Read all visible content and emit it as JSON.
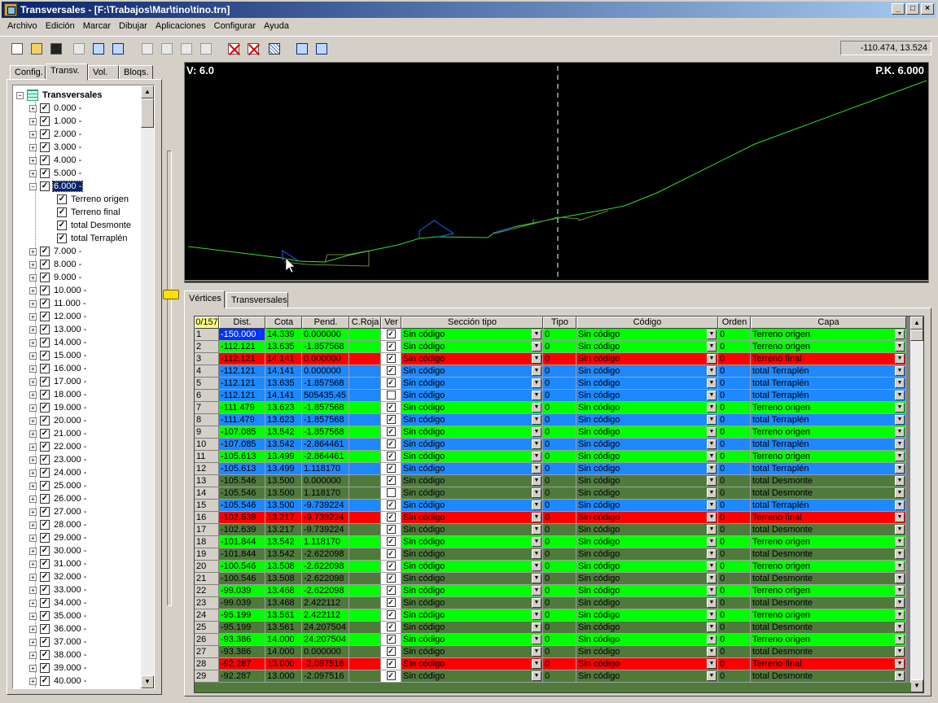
{
  "window": {
    "title": "Transversales - [F:\\Trabajos\\Mar\\tino\\tino.trn]"
  },
  "menu": [
    "Archivo",
    "Edición",
    "Marcar",
    "Dibujar",
    "Aplicaciones",
    "Configurar",
    "Ayuda"
  ],
  "toolbar": {
    "buttons": [
      "new-file-icon",
      "open-folder-icon",
      "save-icon",
      "print-icon",
      "export-icon",
      "import-icon",
      "cut-icon",
      "copy-icon",
      "paste-icon",
      "paste-special-icon",
      "delete-marked-icon",
      "table-icon",
      "hatch-icon",
      "section-prev-icon",
      "section-next-icon"
    ],
    "coords": "-110.474, 13.524"
  },
  "left_tabs": [
    "Config.",
    "Transv.",
    "Vol.",
    "Bloqs."
  ],
  "tree": {
    "root": "Transversales",
    "stations": [
      "0.000 -",
      "1.000 -",
      "2.000 -",
      "3.000 -",
      "4.000 -",
      "5.000 -",
      "6.000 -",
      "7.000 -",
      "8.000 -",
      "9.000 -",
      "10.000 -",
      "11.000 -",
      "12.000 -",
      "13.000 -",
      "14.000 -",
      "15.000 -",
      "16.000 -",
      "17.000 -",
      "18.000 -",
      "19.000 -",
      "20.000 -",
      "21.000 -",
      "22.000 -",
      "23.000 -",
      "24.000 -",
      "25.000 -",
      "26.000 -",
      "27.000 -",
      "28.000 -",
      "29.000 -",
      "30.000 -",
      "31.000 -",
      "32.000 -",
      "33.000 -",
      "34.000 -",
      "35.000 -",
      "36.000 -",
      "37.000 -",
      "38.000 -",
      "39.000 -",
      "40.000 -"
    ],
    "expanded_index": 6,
    "children": [
      "Terreno origen",
      "Terreno final",
      "total Desmonte",
      "total Terraplén"
    ]
  },
  "canvas": {
    "v_label": "V: 6.0",
    "pk_label": "P.K. 6.000"
  },
  "bottom_tabs": [
    "Vértices",
    "Transversales"
  ],
  "grid": {
    "headers": [
      "0/157",
      "Dist.",
      "Cota",
      "Pend.",
      "C.Roja",
      "Ver",
      "Sección tipo",
      "Tipo",
      "Código",
      "Orden",
      "Capa"
    ],
    "colors": {
      "green": "#00ff00",
      "red": "#ff0000",
      "blue": "#1e88ff",
      "olive": "#4f7a3c"
    },
    "rows": [
      {
        "n": "1",
        "dist": "-150.000",
        "cota": "14.339",
        "pend": "0.000000",
        "ver": true,
        "sec": "Sin código",
        "tipo": "0",
        "cod": "Sin código",
        "orden": "0",
        "capa": "Terreno origen",
        "color": "green"
      },
      {
        "n": "2",
        "dist": "-112.121",
        "cota": "13.635",
        "pend": "-1.857568",
        "ver": true,
        "sec": "Sin código",
        "tipo": "0",
        "cod": "Sin código",
        "orden": "0",
        "capa": "Terreno origen",
        "color": "green"
      },
      {
        "n": "3",
        "dist": "-112.121",
        "cota": "14.141",
        "pend": "0.000000",
        "ver": true,
        "sec": "Sin código",
        "tipo": "0",
        "cod": "Sin código",
        "orden": "0",
        "capa": "Terreno final",
        "color": "red"
      },
      {
        "n": "4",
        "dist": "-112.121",
        "cota": "14.141",
        "pend": "0.000000",
        "ver": true,
        "sec": "Sin código",
        "tipo": "0",
        "cod": "Sin código",
        "orden": "0",
        "capa": "total Terraplén",
        "color": "blue"
      },
      {
        "n": "5",
        "dist": "-112.121",
        "cota": "13.635",
        "pend": "-1.857568",
        "ver": true,
        "sec": "Sin código",
        "tipo": "0",
        "cod": "Sin código",
        "orden": "0",
        "capa": "total Terraplén",
        "color": "blue"
      },
      {
        "n": "6",
        "dist": "-112.121",
        "cota": "14.141",
        "pend": "505435.45",
        "ver": false,
        "sec": "Sin código",
        "tipo": "0",
        "cod": "Sin código",
        "orden": "0",
        "capa": "total Terraplén",
        "color": "blue"
      },
      {
        "n": "7",
        "dist": "-111.479",
        "cota": "13.623",
        "pend": "-1.857568",
        "ver": true,
        "sec": "Sin código",
        "tipo": "0",
        "cod": "Sin código",
        "orden": "0",
        "capa": "Terreno origen",
        "color": "green"
      },
      {
        "n": "8",
        "dist": "-111.479",
        "cota": "13.623",
        "pend": "-1.857568",
        "ver": true,
        "sec": "Sin código",
        "tipo": "0",
        "cod": "Sin código",
        "orden": "0",
        "capa": "total Terraplén",
        "color": "blue"
      },
      {
        "n": "9",
        "dist": "-107.085",
        "cota": "13.542",
        "pend": "-1.857568",
        "ver": true,
        "sec": "Sin código",
        "tipo": "0",
        "cod": "Sin código",
        "orden": "0",
        "capa": "Terreno origen",
        "color": "green"
      },
      {
        "n": "10",
        "dist": "-107.085",
        "cota": "13.542",
        "pend": "-2.864461",
        "ver": true,
        "sec": "Sin código",
        "tipo": "0",
        "cod": "Sin código",
        "orden": "0",
        "capa": "total Terraplén",
        "color": "blue"
      },
      {
        "n": "11",
        "dist": "-105.613",
        "cota": "13.499",
        "pend": "-2.864461",
        "ver": true,
        "sec": "Sin código",
        "tipo": "0",
        "cod": "Sin código",
        "orden": "0",
        "capa": "Terreno origen",
        "color": "green"
      },
      {
        "n": "12",
        "dist": "-105.613",
        "cota": "13.499",
        "pend": "1.118170",
        "ver": true,
        "sec": "Sin código",
        "tipo": "0",
        "cod": "Sin código",
        "orden": "0",
        "capa": "total Terraplén",
        "color": "blue"
      },
      {
        "n": "13",
        "dist": "-105.546",
        "cota": "13.500",
        "pend": "0.000000",
        "ver": true,
        "sec": "Sin código",
        "tipo": "0",
        "cod": "Sin código",
        "orden": "0",
        "capa": "total Desmonte",
        "color": "olive"
      },
      {
        "n": "14",
        "dist": "-105.546",
        "cota": "13.500",
        "pend": "1.118170",
        "ver": false,
        "sec": "Sin código",
        "tipo": "0",
        "cod": "Sin código",
        "orden": "0",
        "capa": "total Desmonte",
        "color": "olive"
      },
      {
        "n": "15",
        "dist": "-105.546",
        "cota": "13.500",
        "pend": "-9.739224",
        "ver": true,
        "sec": "Sin código",
        "tipo": "0",
        "cod": "Sin código",
        "orden": "0",
        "capa": "total Terraplén",
        "color": "blue"
      },
      {
        "n": "16",
        "dist": "-102.639",
        "cota": "13.217",
        "pend": "-9.739224",
        "ver": true,
        "sec": "Sin código",
        "tipo": "0",
        "cod": "Sin código",
        "orden": "0",
        "capa": "Terreno final",
        "color": "red"
      },
      {
        "n": "17",
        "dist": "-102.639",
        "cota": "13.217",
        "pend": "-9.739224",
        "ver": true,
        "sec": "Sin código",
        "tipo": "0",
        "cod": "Sin código",
        "orden": "0",
        "capa": "total Desmonte",
        "color": "olive"
      },
      {
        "n": "18",
        "dist": "-101.844",
        "cota": "13.542",
        "pend": "1.118170",
        "ver": true,
        "sec": "Sin código",
        "tipo": "0",
        "cod": "Sin código",
        "orden": "0",
        "capa": "Terreno origen",
        "color": "green"
      },
      {
        "n": "19",
        "dist": "-101.844",
        "cota": "13.542",
        "pend": "-2.622098",
        "ver": true,
        "sec": "Sin código",
        "tipo": "0",
        "cod": "Sin código",
        "orden": "0",
        "capa": "total Desmonte",
        "color": "olive"
      },
      {
        "n": "20",
        "dist": "-100.546",
        "cota": "13.508",
        "pend": "-2.622098",
        "ver": true,
        "sec": "Sin código",
        "tipo": "0",
        "cod": "Sin código",
        "orden": "0",
        "capa": "Terreno origen",
        "color": "green"
      },
      {
        "n": "21",
        "dist": "-100.546",
        "cota": "13.508",
        "pend": "-2.622098",
        "ver": true,
        "sec": "Sin código",
        "tipo": "0",
        "cod": "Sin código",
        "orden": "0",
        "capa": "total Desmonte",
        "color": "olive"
      },
      {
        "n": "22",
        "dist": "-99.039",
        "cota": "13.468",
        "pend": "-2.622098",
        "ver": true,
        "sec": "Sin código",
        "tipo": "0",
        "cod": "Sin código",
        "orden": "0",
        "capa": "Terreno origen",
        "color": "green"
      },
      {
        "n": "23",
        "dist": "-99.039",
        "cota": "13.468",
        "pend": "2.422112",
        "ver": true,
        "sec": "Sin código",
        "tipo": "0",
        "cod": "Sin código",
        "orden": "0",
        "capa": "total Desmonte",
        "color": "olive"
      },
      {
        "n": "24",
        "dist": "-95.199",
        "cota": "13.561",
        "pend": "2.422112",
        "ver": true,
        "sec": "Sin código",
        "tipo": "0",
        "cod": "Sin código",
        "orden": "0",
        "capa": "Terreno origen",
        "color": "green"
      },
      {
        "n": "25",
        "dist": "-95.199",
        "cota": "13.561",
        "pend": "24.207504",
        "ver": true,
        "sec": "Sin código",
        "tipo": "0",
        "cod": "Sin código",
        "orden": "0",
        "capa": "total Desmonte",
        "color": "olive"
      },
      {
        "n": "26",
        "dist": "-93.386",
        "cota": "14.000",
        "pend": "24.207504",
        "ver": true,
        "sec": "Sin código",
        "tipo": "0",
        "cod": "Sin código",
        "orden": "0",
        "capa": "Terreno origen",
        "color": "green"
      },
      {
        "n": "27",
        "dist": "-93.386",
        "cota": "14.000",
        "pend": "0.000000",
        "ver": true,
        "sec": "Sin código",
        "tipo": "0",
        "cod": "Sin código",
        "orden": "0",
        "capa": "total Desmonte",
        "color": "olive"
      },
      {
        "n": "28",
        "dist": "-92.287",
        "cota": "13.000",
        "pend": "-2.097516",
        "ver": true,
        "sec": "Sin código",
        "tipo": "0",
        "cod": "Sin código",
        "orden": "0",
        "capa": "Terreno final",
        "color": "red"
      },
      {
        "n": "29",
        "dist": "-92.287",
        "cota": "13.000",
        "pend": "-2.097516",
        "ver": true,
        "sec": "Sin código",
        "tipo": "0",
        "cod": "Sin código",
        "orden": "0",
        "capa": "total Desmonte",
        "color": "olive"
      }
    ]
  }
}
